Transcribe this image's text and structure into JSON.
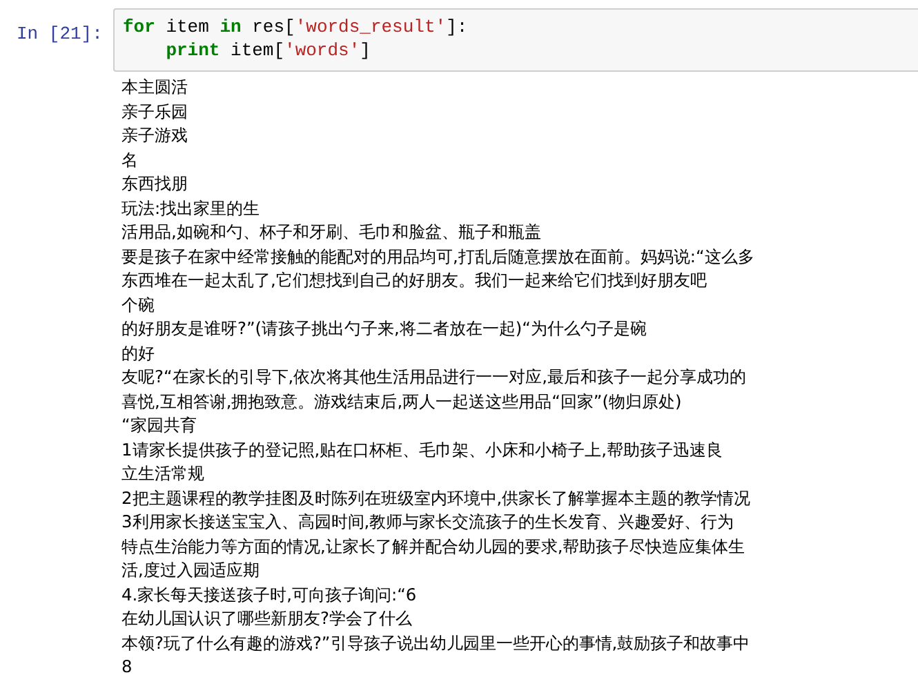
{
  "cell": {
    "prompt": "In [21]:",
    "code_lines": [
      {
        "indent": false,
        "tokens": [
          {
            "kind": "keyword",
            "text": "for"
          },
          {
            "kind": "name",
            "text": " item "
          },
          {
            "kind": "keyword",
            "text": "in"
          },
          {
            "kind": "name",
            "text": " res["
          },
          {
            "kind": "string",
            "text": "'words_result'"
          },
          {
            "kind": "name",
            "text": "]:"
          }
        ]
      },
      {
        "indent": true,
        "tokens": [
          {
            "kind": "keyword",
            "text": "print"
          },
          {
            "kind": "name",
            "text": " item["
          },
          {
            "kind": "string",
            "text": "'words'"
          },
          {
            "kind": "name",
            "text": "]"
          }
        ]
      }
    ]
  },
  "output_lines": [
    "本主圆活",
    "亲子乐园",
    "亲子游戏",
    "名",
    "东西找朋",
    "玩法:找出家里的生",
    "活用品,如碗和勺、杯子和牙刷、毛巾和脸盆、瓶子和瓶盖",
    "要是孩子在家中经常接触的能配对的用品均可,打乱后随意摆放在面前。妈妈说:“这么多",
    "东西堆在一起太乱了,它们想找到自己的好朋友。我们一起来给它们找到好朋友吧",
    "个碗",
    "的好朋友是谁呀?”(请孩子挑出勺子来,将二者放在一起)“为什么勺子是碗",
    "的好",
    "友呢?“在家长的引导下,依次将其他生活用品进行一一对应,最后和孩子一起分享成功的",
    "喜悦,互相答谢,拥抱致意。游戏结束后,两人一起送这些用品“回家”(物归原处)",
    "“家园共育",
    "1请家长提供孩子的登记照,贴在口杯柜、毛巾架、小床和小椅子上,帮助孩子迅速良",
    "立生活常规",
    "2把主题课程的教学挂图及时陈列在班级室内环境中,供家长了解掌握本主题的教学情况",
    "3利用家长接送宝宝入、高园时间,教师与家长交流孩子的生长发育、兴趣爱好、行为",
    "特点生治能力等方面的情况,让家长了解并配合幼儿园的要求,帮助孩子尽快造应集体生",
    "活,度过入园适应期",
    "4.家长每天接送孩子时,可向孩子询问:“6",
    "在幼儿国认识了哪些新朋友?学会了什么",
    "本领?玩了什么有趣的游戏?”引导孩子说出幼儿园里一些开心的事情,鼓励孩子和故事中",
    "8"
  ]
}
